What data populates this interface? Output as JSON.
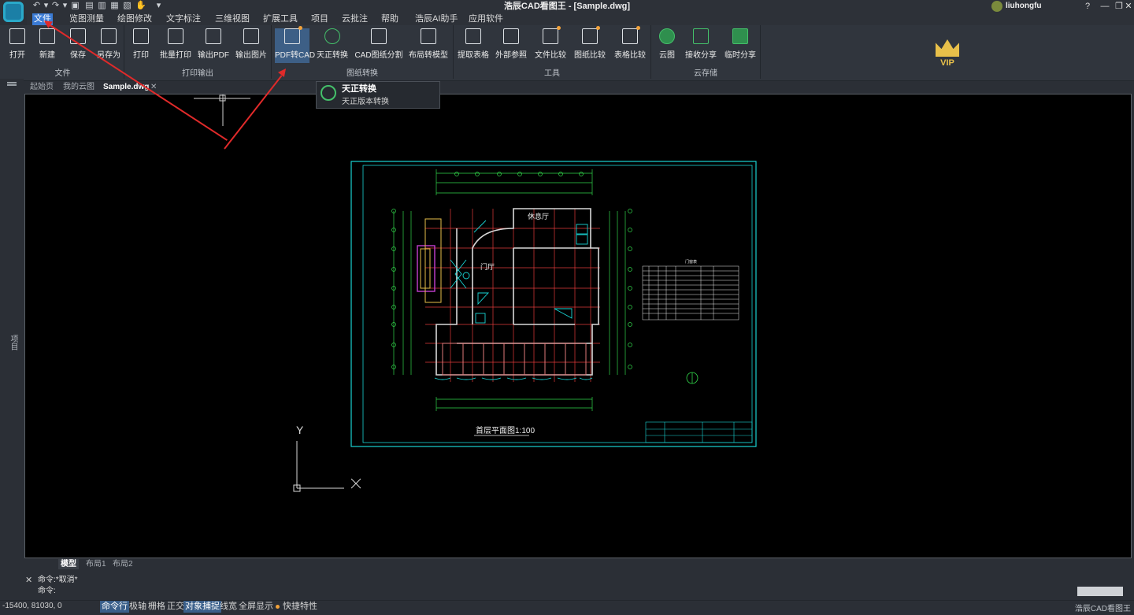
{
  "window": {
    "title": "浩辰CAD看图王 - [Sample.dwg]",
    "user": "liuhongfu"
  },
  "quick_access": [
    "↶",
    "▾",
    "↷",
    "▾",
    "▣",
    "▤",
    "▥",
    "▦",
    "▧",
    "✋",
    "▾"
  ],
  "menu": [
    {
      "label": "文件",
      "active": true
    },
    {
      "label": "览图测量"
    },
    {
      "label": "绘图修改"
    },
    {
      "label": "文字标注"
    },
    {
      "label": "三维视图"
    },
    {
      "label": "扩展工具"
    },
    {
      "label": "项目"
    },
    {
      "label": "云批注"
    },
    {
      "label": "帮助"
    },
    {
      "label": "浩辰AI助手"
    },
    {
      "label": "应用软件"
    }
  ],
  "ribbon": {
    "groups": [
      {
        "label": "文件",
        "buttons": [
          "打开",
          "新建",
          "保存",
          "另存为"
        ]
      },
      {
        "label": "打印输出",
        "buttons": [
          "打印",
          "批量打印",
          "输出PDF",
          "输出图片"
        ]
      },
      {
        "label": "图纸转换",
        "buttons": [
          "PDF转CAD",
          "天正转换",
          "CAD图纸分割",
          "布局转模型"
        ]
      },
      {
        "label": "工具",
        "buttons": [
          "提取表格",
          "外部参照",
          "文件比较",
          "图纸比较",
          "表格比较"
        ]
      },
      {
        "label": "云存储",
        "buttons": [
          "云图",
          "接收分享",
          "临时分享"
        ]
      }
    ],
    "vip": "VIP"
  },
  "doc_tabs": [
    "起始页",
    "我的云图",
    "Sample.dwg"
  ],
  "tooltip": {
    "title": "天正转换",
    "desc": "天正版本转换"
  },
  "left_rail": "项目",
  "drawing": {
    "title": "首层平面图1:100",
    "hall": "休息厅",
    "lobby": "门厅",
    "table_title": "门窗表",
    "axis_y": "Y",
    "axis_x": "X"
  },
  "layout_tabs": [
    "模型",
    "布局1",
    "布局2"
  ],
  "command": {
    "line1": "命令:*取消*",
    "line2": "命令:"
  },
  "status": {
    "coords": "-15400, 81030, 0",
    "items": [
      {
        "label": "命令行",
        "on": true
      },
      {
        "label": "极轴"
      },
      {
        "label": "栅格"
      },
      {
        "label": "正交"
      },
      {
        "label": "对象捕捉",
        "on": true
      },
      {
        "label": "线宽"
      },
      {
        "label": "全屏显示"
      },
      {
        "label": "快捷特性"
      }
    ],
    "app": "浩辰CAD看图王"
  },
  "colors": {
    "accent": "#3a7bd5",
    "vip": "#e8c04a",
    "cad_cyan": "#19d3d3",
    "cad_red": "#e23a3a",
    "cad_green": "#31d64a"
  }
}
